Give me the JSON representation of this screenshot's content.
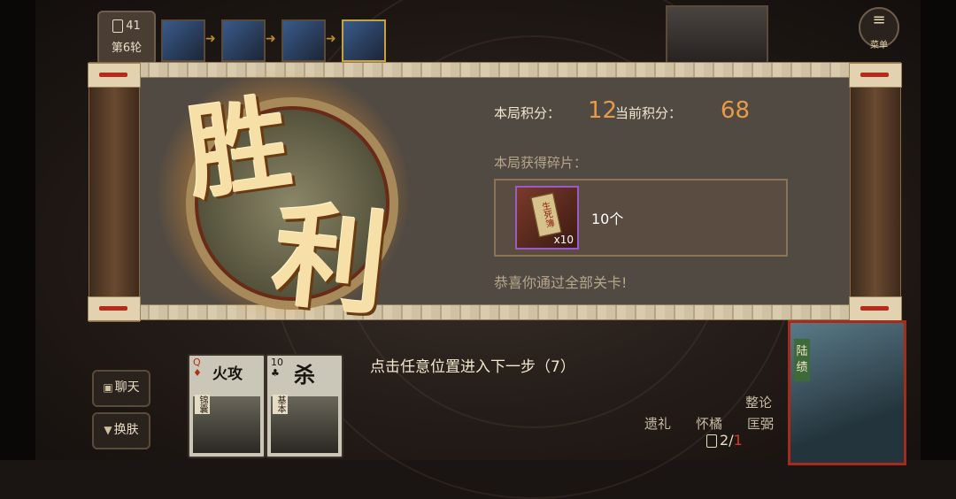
{
  "top": {
    "round_count": "41",
    "round_label": "第6轮",
    "menu_label": "菜单"
  },
  "result": {
    "victory_char1": "胜",
    "victory_char2": "利",
    "round_score_label": "本局积分：",
    "round_score_value": "12",
    "current_score_label": "当前积分：",
    "current_score_value": "68",
    "fragments_label": "本局获得碎片：",
    "fragment_item_name": "生死簿",
    "fragment_multiplier": "x10",
    "fragment_count_text": "10个",
    "congrats_text": "恭喜你通过全部关卡!"
  },
  "bottom": {
    "continue_prompt": "点击任意位置进入下一步（7）",
    "chat_button": "聊天",
    "skin_button": "换肤",
    "hand_cards": [
      {
        "rank": "Q",
        "suit": "♦",
        "name": "火攻",
        "tag": "锦囊"
      },
      {
        "rank": "10",
        "suit": "♣",
        "name": "杀",
        "tag": "基本"
      }
    ],
    "skills": [
      "整论",
      "遗礼",
      "怀橘",
      "匡弼"
    ],
    "hand_count": "2",
    "hand_max": "1",
    "hero_name": "陆绩"
  },
  "colors": {
    "score_value": "#e79a48",
    "hand_max": "#d83a2a"
  }
}
